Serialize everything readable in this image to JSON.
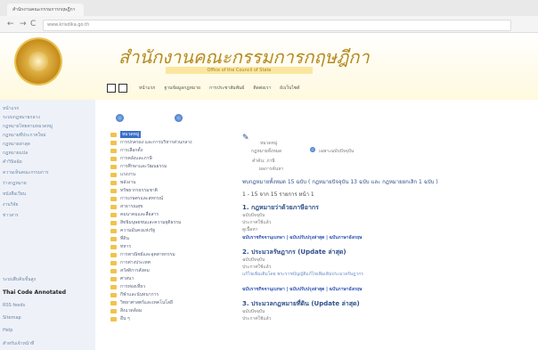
{
  "browser": {
    "tab_title": "สำนักงานคณะกรรมการกฤษฎีกา",
    "back_glyph": "←",
    "forward_glyph": "→",
    "reload_glyph": "C",
    "url": "www.krisdika.go.th"
  },
  "header": {
    "site_title": "สำนักงานคณะกรรมการกฤษฎีกา",
    "subtitle": "Office of the Council of State",
    "nav": [
      "หน้าแรก",
      "ฐานข้อมูลกฎหมาย",
      "การประชาสัมพันธ์",
      "ติดต่อเรา",
      "ผังเว็บไซต์"
    ]
  },
  "sidebar": {
    "items": [
      "หน้าแรก",
      "ระบบกฎหมายกลาง",
      "กฎหมายไทยตามหมวดหมู่",
      "กฎหมายที่ประกาศใหม่",
      "กฎหมายล่าสุด",
      "กฎหมายแปล",
      "คำวินิจฉัย",
      "ความเห็นคณะกรรมการ",
      "ร่างกฎหมาย",
      "หนังสือเวียน",
      "งานวิจัย",
      "ข่าวสาร",
      "ระบบสืบค้นขั้นสูง",
      "Thai Code Annotated",
      "RSS feeds",
      "Sitemap",
      "Help",
      "สำหรับเจ้าหน้าที่"
    ],
    "bold_item": "Thai Code Annotated"
  },
  "tree": {
    "selected": "หมวดหมู่",
    "items": [
      "หมวดหมู่",
      "การปกครอง และการบริหารส่วนกลาง",
      "การเลือกตั้ง",
      "การคลังและภาษี",
      "การศึกษาและวัฒนธรรม",
      "แรงงาน",
      "พลังงาน",
      "ทรัพยากรธรรมชาติ",
      "การเกษตรและสหกรณ์",
      "สาธารณสุข",
      "คมนาคมและสื่อสาร",
      "สิทธิมนุษยชนและความยุติธรรม",
      "ความมั่นคงแห่งรัฐ",
      "ที่ดิน",
      "ทหาร",
      "การพาณิชย์และอุตสาหกรรม",
      "การต่างประเทศ",
      "สวัสดิการสังคม",
      "ศาสนา",
      "การท่องเที่ยว",
      "กีฬาและนันทนาการ",
      "วิทยาศาสตร์และเทคโนโลยี",
      "สิ่งแวดล้อม",
      "อื่น ๆ"
    ]
  },
  "content": {
    "section_label": "หมวดหมู่",
    "filter_label": "กฎหมายทั้งหมด",
    "option_label": "เฉพาะฉบับปัจจุบัน",
    "bullet_line": "คำค้น: ภาษี",
    "sub_line": "ผลการค้นหา",
    "results_summary": "พบกฎหมายทั้งหมด 15 ฉบับ ( กฎหมายปัจจุบัน 13 ฉบับ และ กฎหมายยกเลิก 1 ฉบับ )",
    "pager": "1 - 15 จาก 15 รายการ   หน้า 1",
    "results": [
      {
        "title": "1. กฎหมายว่าด้วยภาษีอากร",
        "lines": [
          "ฉบับปัจจุบัน",
          "ประกาศใช้แล้ว",
          "ดูเนื้อหา"
        ],
        "link": "ฉบับราชกิจจานุเบกษา | ฉบับปรับปรุงล่าสุด | ฉบับภาษาอังกฤษ"
      },
      {
        "title": "2. ประมวลรัษฎากร (Update ล่าสุด)",
        "lines": [
          "ฉบับปัจจุบัน",
          "ประกาศใช้แล้ว",
          "แก้ไขเพิ่มเติมโดย พระราชบัญญัติแก้ไขเพิ่มเติมประมวลรัษฎากร"
        ],
        "link": "ฉบับราชกิจจานุเบกษา | ฉบับปรับปรุงล่าสุด | ฉบับภาษาอังกฤษ"
      },
      {
        "title": "3. ประมวลกฎหมายที่ดิน (Update ล่าสุด)",
        "lines": [
          "ฉบับปัจจุบัน",
          "ประกาศใช้แล้ว"
        ],
        "link": ""
      }
    ]
  }
}
